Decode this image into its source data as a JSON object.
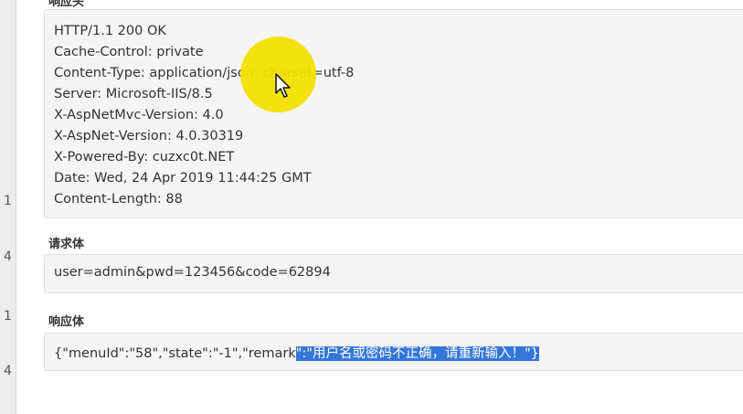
{
  "left_rows": [
    "1",
    "4",
    "1",
    "4"
  ],
  "section_top_clipped": "响应头",
  "response_headers": [
    "HTTP/1.1 200 OK",
    "Cache-Control: private",
    "Content-Type: application/json; charset=utf-8",
    "Server: Microsoft-IIS/8.5",
    "X-AspNetMvc-Version: 4.0",
    "X-AspNet-Version: 4.0.30319",
    "X-Powered-By: cuzxc0t.NET",
    "Date: Wed, 24 Apr 2019 11:44:25 GMT",
    "Content-Length: 88"
  ],
  "request_body_label": "请求体",
  "request_body": "user=admin&pwd=123456&code=62894",
  "response_body_label": "响应体",
  "response_body_plain": "{\"menuId\":\"58\",\"state\":\"-1\",\"remark",
  "response_body_selected": "\":\"用户名或密码不正确，请重新输入！\"}",
  "colors": {
    "selection": "#3477d9",
    "cursor_highlight": "#f3df00"
  }
}
